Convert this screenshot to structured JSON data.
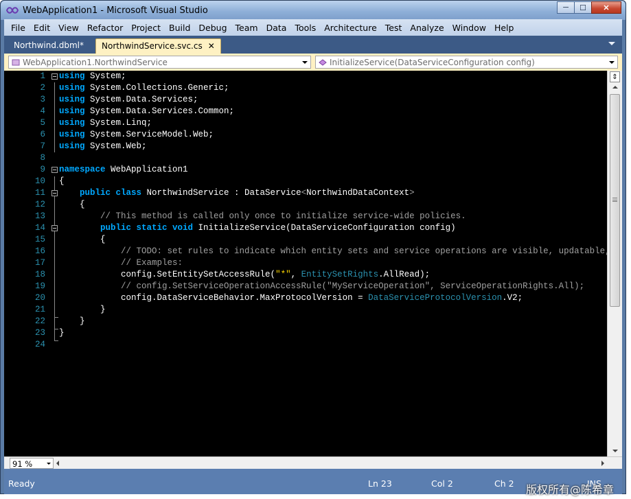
{
  "window": {
    "title": "WebApplication1 - Microsoft Visual Studio",
    "minimize": "─",
    "maximize": "☐",
    "close": "✕"
  },
  "menu": [
    "File",
    "Edit",
    "View",
    "Refactor",
    "Project",
    "Build",
    "Debug",
    "Team",
    "Data",
    "Tools",
    "Architecture",
    "Test",
    "Analyze",
    "Window",
    "Help"
  ],
  "tabs": [
    {
      "label": "Northwind.dbml*",
      "active": false
    },
    {
      "label": "NorthwindService.svc.cs",
      "active": true,
      "close": "✕"
    }
  ],
  "navbar": {
    "type_combo": "WebApplication1.NorthwindService",
    "member_combo": "InitializeService(DataServiceConfiguration config)"
  },
  "code": {
    "lines": [
      {
        "n": "1"
      },
      {
        "n": "2"
      },
      {
        "n": "3"
      },
      {
        "n": "4"
      },
      {
        "n": "5"
      },
      {
        "n": "6"
      },
      {
        "n": "7"
      },
      {
        "n": "8"
      },
      {
        "n": "9"
      },
      {
        "n": "10"
      },
      {
        "n": "11"
      },
      {
        "n": "12"
      },
      {
        "n": "13"
      },
      {
        "n": "14"
      },
      {
        "n": "15"
      },
      {
        "n": "16"
      },
      {
        "n": "17"
      },
      {
        "n": "18"
      },
      {
        "n": "19"
      },
      {
        "n": "20"
      },
      {
        "n": "21"
      },
      {
        "n": "22"
      },
      {
        "n": "23"
      },
      {
        "n": "24"
      }
    ],
    "t": {
      "using": "using",
      "l1": " System;",
      "l2": " System.Collections.Generic;",
      "l3": " System.Data.Services;",
      "l4": " System.Data.Services.Common;",
      "l5": " System.Linq;",
      "l6": " System.ServiceModel.Web;",
      "l7": " System.Web;",
      "namespace": "namespace",
      "l9": " WebApplication1",
      "l10": "{",
      "l11_kw": "    public class",
      "l11_a": " NorthwindService : DataService",
      "l11_lt": "<",
      "l11_b": "NorthwindDataContext",
      "l11_gt": ">",
      "l12": "    {",
      "l13": "        // This method is called only once to initialize service-wide policies.",
      "l14_kw": "        public static void",
      "l14_a": " InitializeService(DataServiceConfiguration config)",
      "l15": "        {",
      "l16": "            // TODO: set rules to indicate which entity sets and service operations are visible, updatable, etc.",
      "l17": "            // Examples:",
      "l18_a": "            config.SetEntitySetAccessRule(",
      "l18_s": "\"*\"",
      "l18_b": ", ",
      "l18_t": "EntitySetRights",
      "l18_c": ".AllRead);",
      "l19": "            // config.SetServiceOperationAccessRule(\"MyServiceOperation\", ServiceOperationRights.All);",
      "l20_a": "            config.DataServiceBehavior.MaxProtocolVersion = ",
      "l20_t": "DataServiceProtocolVersion",
      "l20_b": ".V2;",
      "l21": "        }",
      "l22": "    }",
      "l23": "}"
    }
  },
  "zoom": "91 %",
  "status": {
    "ready": "Ready",
    "ln": "Ln 23",
    "col": "Col 2",
    "ch": "Ch 2",
    "ins": "INS"
  },
  "watermark": "版权所有@陈希章",
  "colors": {
    "keyword": "#00a8ff",
    "type": "#2b91af",
    "comment": "#a0a0a0",
    "string": "#ffd700",
    "line_number": "#2b91af",
    "statusbar": "#5b7eb0"
  }
}
